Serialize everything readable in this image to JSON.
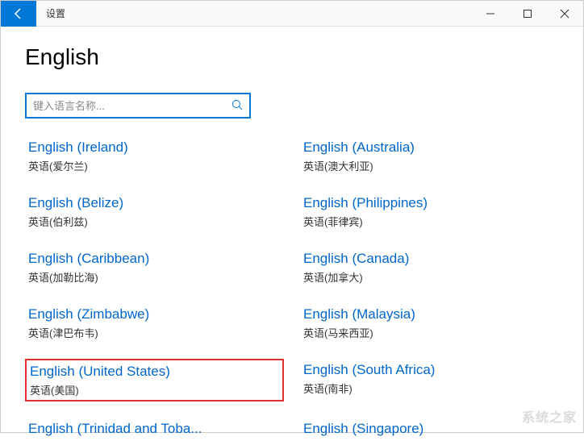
{
  "window": {
    "title": "设置"
  },
  "page": {
    "title": "English"
  },
  "search": {
    "placeholder": "键入语言名称...",
    "value": ""
  },
  "languages": [
    {
      "name": "English (Ireland)",
      "sub": "英语(爱尔兰)",
      "highlighted": false
    },
    {
      "name": "English (Australia)",
      "sub": "英语(澳大利亚)",
      "highlighted": false
    },
    {
      "name": "English (Belize)",
      "sub": "英语(伯利兹)",
      "highlighted": false
    },
    {
      "name": "English (Philippines)",
      "sub": "英语(菲律宾)",
      "highlighted": false
    },
    {
      "name": "English (Caribbean)",
      "sub": "英语(加勒比海)",
      "highlighted": false
    },
    {
      "name": "English (Canada)",
      "sub": "英语(加拿大)",
      "highlighted": false
    },
    {
      "name": "English (Zimbabwe)",
      "sub": "英语(津巴布韦)",
      "highlighted": false
    },
    {
      "name": "English (Malaysia)",
      "sub": "英语(马来西亚)",
      "highlighted": false
    },
    {
      "name": "English (United States)",
      "sub": "英语(美国)",
      "highlighted": true
    },
    {
      "name": "English (South Africa)",
      "sub": "英语(南非)",
      "highlighted": false
    },
    {
      "name": "English (Trinidad and Toba...",
      "sub": "",
      "highlighted": false
    },
    {
      "name": "English (Singapore)",
      "sub": "",
      "highlighted": false
    }
  ],
  "watermark": "系统之家"
}
